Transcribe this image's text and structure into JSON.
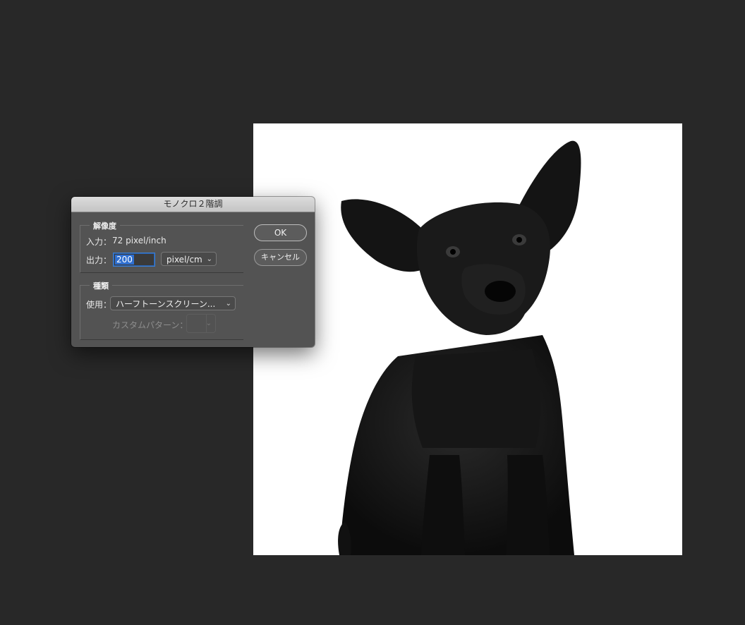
{
  "dialog": {
    "title": "モノクロ２階調",
    "resolution": {
      "legend": "解像度",
      "input_label": "入力：",
      "input_value": "72 pixel/inch",
      "output_label": "出力：",
      "output_value": "200",
      "output_unit": "pixel/cm"
    },
    "kind": {
      "legend": "種類",
      "use_label": "使用：",
      "use_value": "ハーフトーンスクリーン...",
      "custom_pattern_label": "カスタムパターン："
    },
    "ok_label": "OK",
    "cancel_label": "キャンセル"
  },
  "colors": {
    "workspace": "#282828",
    "dialog_bg": "#535353",
    "selection": "#2f6fd0"
  },
  "icons": {
    "dropdown": "chevron-down-icon"
  }
}
